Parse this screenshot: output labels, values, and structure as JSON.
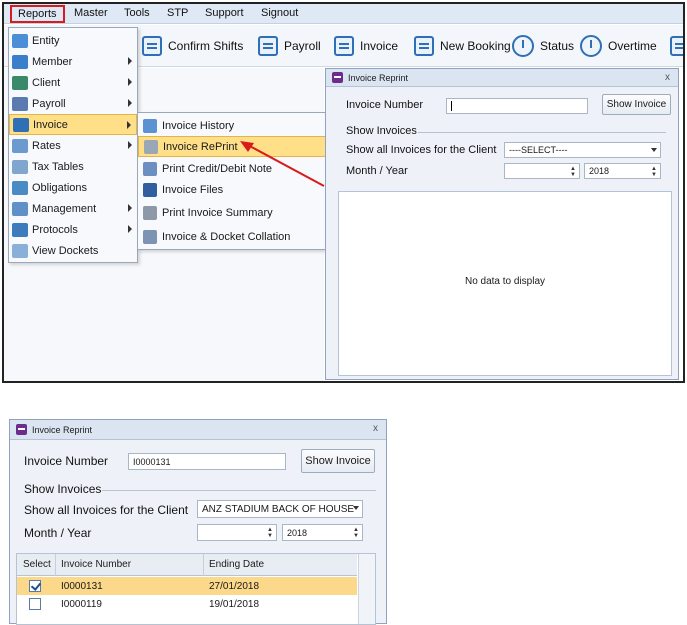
{
  "menubar": {
    "items": [
      "Reports",
      "Master",
      "Tools",
      "STP",
      "Support",
      "Signout"
    ]
  },
  "toolbar": {
    "buttons": [
      "Confirm Shifts",
      "Payroll",
      "Invoice",
      "New Booking",
      "Status",
      "Overtime"
    ]
  },
  "reports_menu": {
    "items": [
      "Entity",
      "Member",
      "Client",
      "Payroll",
      "Invoice",
      "Rates",
      "Tax Tables",
      "Obligations",
      "Management",
      "Protocols",
      "View Dockets"
    ],
    "highlighted": "Invoice"
  },
  "invoice_submenu": {
    "items": [
      "Invoice History",
      "Invoice RePrint",
      "Print Credit/Debit Note",
      "Invoice Files",
      "Print Invoice Summary",
      "Invoice & Docket Collation"
    ],
    "highlighted": "Invoice RePrint"
  },
  "reprint_window_top": {
    "title": "Invoice Reprint",
    "close": "x",
    "invoice_number_label": "Invoice Number",
    "invoice_number_value": "",
    "show_invoice_button": "Show Invoice",
    "group_label": "Show Invoices",
    "client_label": "Show all Invoices for the Client",
    "client_value": "----SELECT----",
    "month_year_label": "Month / Year",
    "month_value": "",
    "year_value": "2018",
    "empty_text": "No data to display"
  },
  "reprint_window_bottom": {
    "title": "Invoice Reprint",
    "close": "x",
    "invoice_number_label": "Invoice Number",
    "invoice_number_value": "I0000131",
    "show_invoice_button": "Show Invoice",
    "group_label": "Show Invoices",
    "client_label": "Show all Invoices for the Client",
    "client_value": "ANZ STADIUM BACK OF HOUSE",
    "month_year_label": "Month / Year",
    "month_value": "",
    "year_value": "2018",
    "grid": {
      "columns": [
        "Select",
        "Invoice Number",
        "Ending Date"
      ],
      "rows": [
        {
          "selected": true,
          "invoice_number": "I0000131",
          "ending_date": "27/01/2018"
        },
        {
          "selected": false,
          "invoice_number": "I0000119",
          "ending_date": "19/01/2018"
        }
      ]
    }
  },
  "colors": {
    "highlight": "#ffe089",
    "accent": "#2f6fb5",
    "annotation_red": "#d81c1c"
  }
}
